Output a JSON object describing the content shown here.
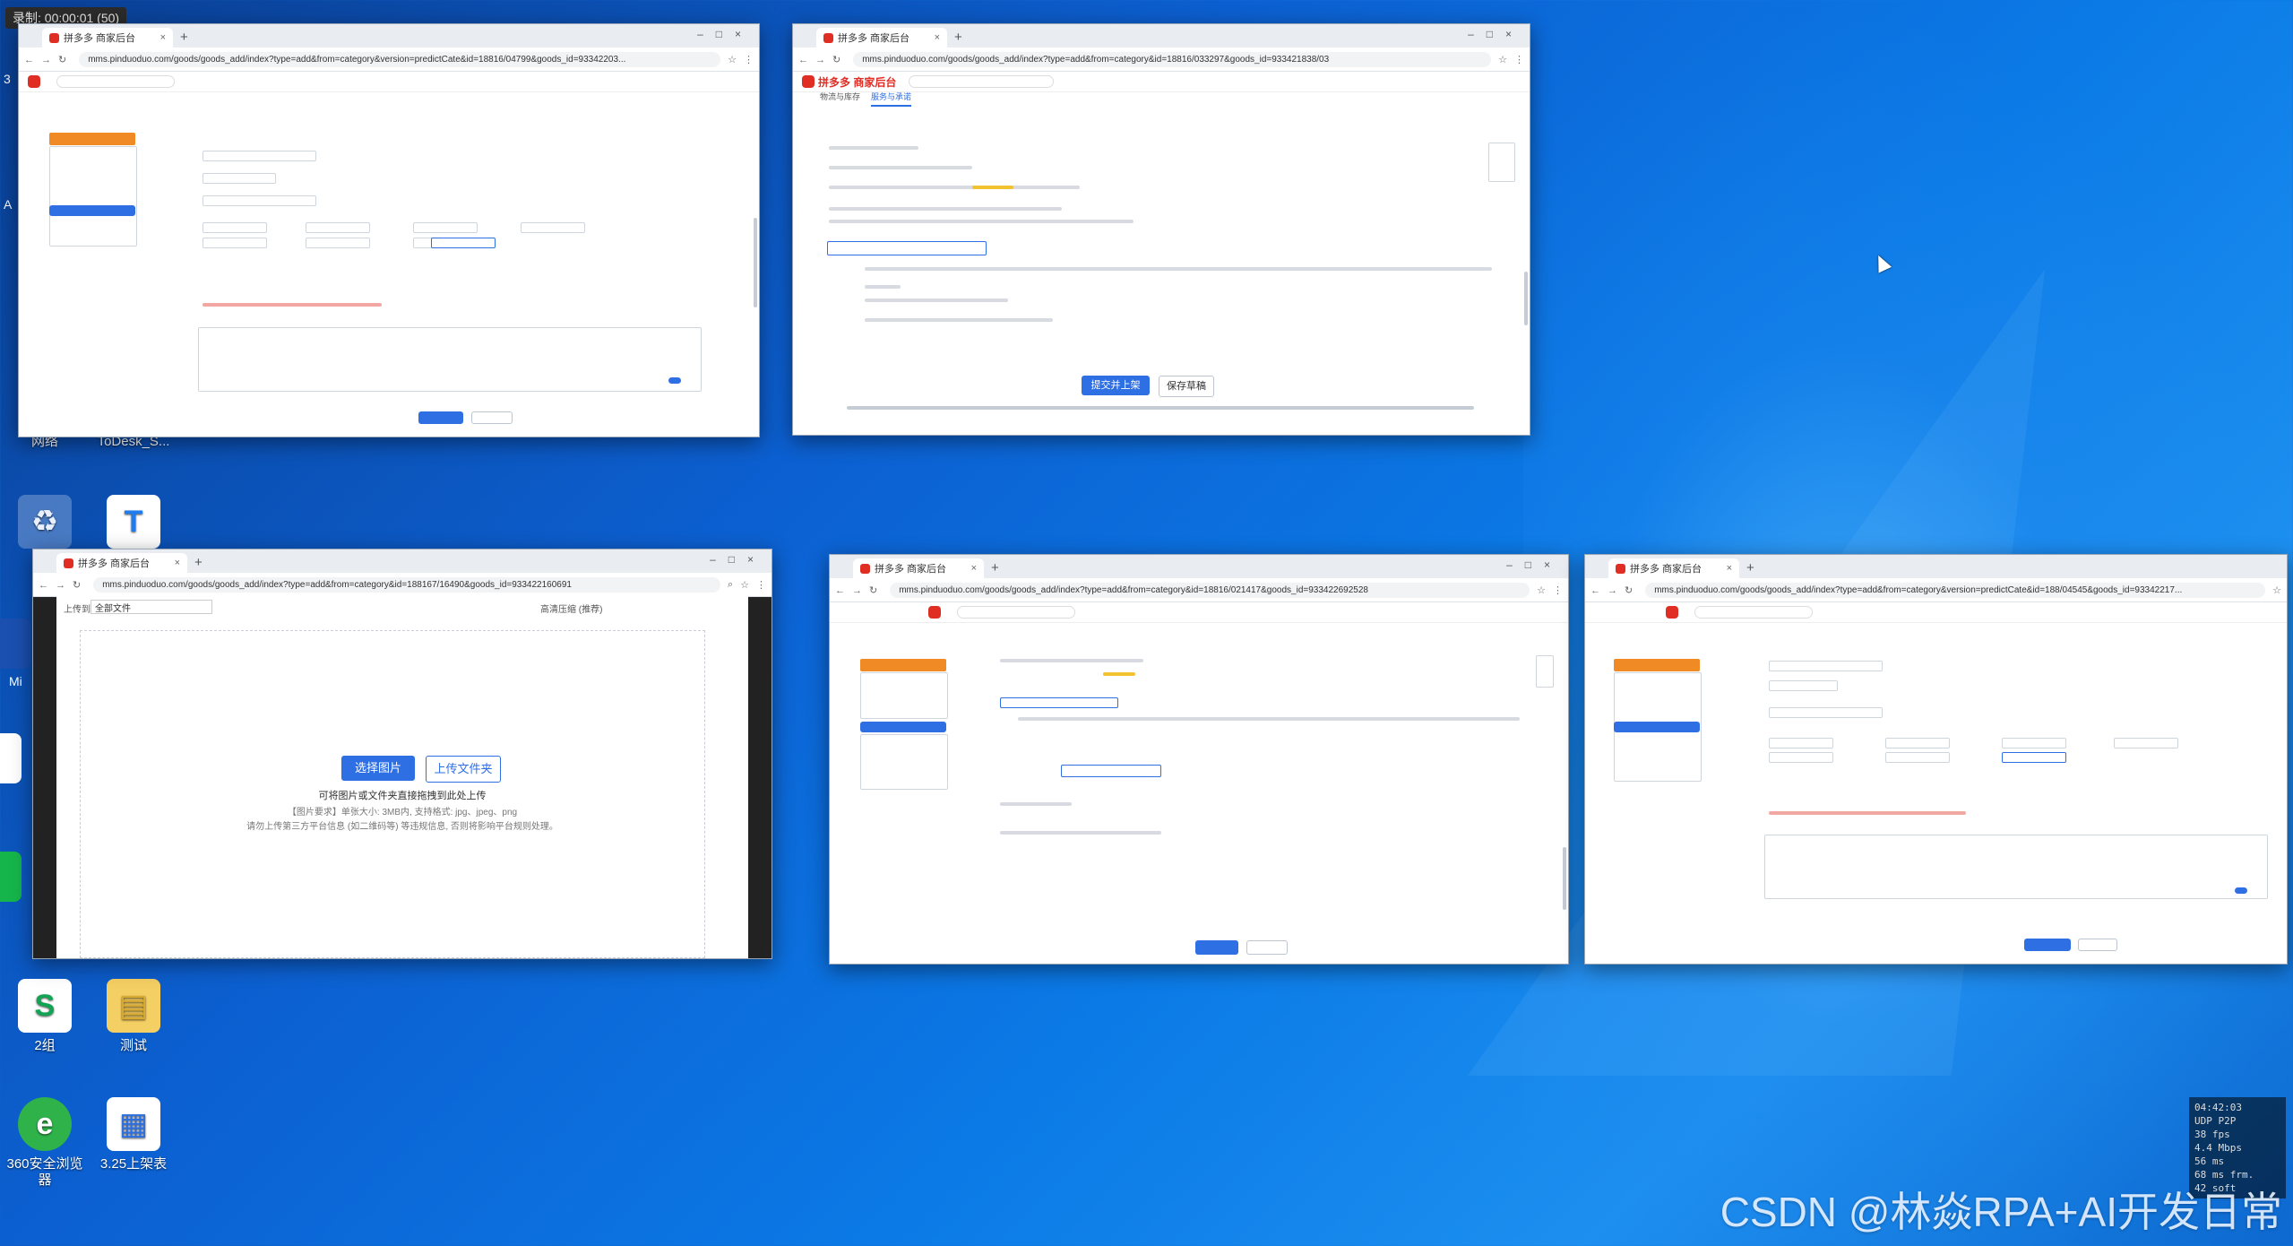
{
  "recording": {
    "label": "录制: 00:00:01 (50)"
  },
  "desktop": {
    "icons": [
      {
        "label": "网络"
      },
      {
        "label": "ToDesk_S..."
      },
      {
        "label": "2组"
      },
      {
        "label": "测试"
      },
      {
        "label": "360安全浏览器"
      },
      {
        "label": "3.25上架表"
      }
    ],
    "edge_labels": {
      "a": "3",
      "b": "A",
      "c": "Mi"
    }
  },
  "windows": {
    "tab_title": "拼多多 商家后台",
    "w1": {
      "url": "mms.pinduoduo.com/goods/goods_add/index?type=add&from=category&version=predictCate&id=18816/04799&goods_id=93342203..."
    },
    "w2": {
      "url": "mms.pinduoduo.com/goods/goods_add/index?type=add&from=category&id=18816/033297&goods_id=933421838/03",
      "logo": "拼多多 商家后台",
      "tabs": [
        "物流与库存",
        "服务与承诺"
      ],
      "submit": "提交并上架",
      "save": "保存草稿"
    },
    "w3": {
      "url": "mms.pinduoduo.com/goods/goods_add/index?type=add&from=category&id=188167/16490&goods_id=933422160691",
      "upload_label": "上传到",
      "folder": "全部文件",
      "option": "高清压缩 (推荐)",
      "choose_image": "选择图片",
      "upload_folder": "上传文件夹",
      "hint": "可将图片或文件夹直接拖拽到此处上传",
      "req1": "【图片要求】单张大小: 3MB内, 支持格式: jpg、jpeg、png",
      "req2": "请勿上传第三方平台信息 (如二维码等) 等违规信息, 否则将影响平台规则处理。"
    },
    "w4": {
      "url": "mms.pinduoduo.com/goods/goods_add/index?type=add&from=category&id=18816/021417&goods_id=933422692528"
    },
    "w5": {
      "url": "mms.pinduoduo.com/goods/goods_add/index?type=add&from=category&version=predictCate&id=188/04545&goods_id=93342217..."
    }
  },
  "stats": {
    "time": "04:42:03",
    "proto": "UDP P2P",
    "fps": "38 fps",
    "bitrate": "4.4 Mbps",
    "latency": "56 ms",
    "frame": "68 ms frm.",
    "codec": "42 soft"
  },
  "watermark": "CSDN @林焱RPA+AI开发日常"
}
